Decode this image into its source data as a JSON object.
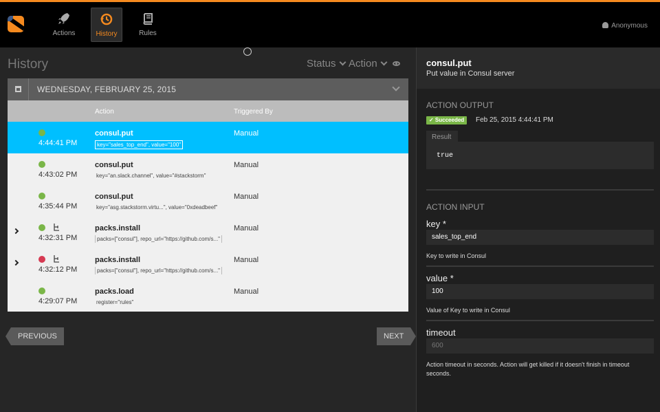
{
  "nav": {
    "items": [
      {
        "label": "Actions",
        "icon": "rocket-icon"
      },
      {
        "label": "History",
        "icon": "history-icon"
      },
      {
        "label": "Rules",
        "icon": "book-icon"
      }
    ],
    "user": "Anonymous"
  },
  "history": {
    "title": "History",
    "filters": {
      "status": "Status",
      "action": "Action"
    },
    "date": "WEDNESDAY, FEBRUARY 25, 2015",
    "columns": {
      "action": "Action",
      "triggered_by": "Triggered By"
    },
    "rows": [
      {
        "time": "4:44:41 PM",
        "action": "consul.put",
        "params": "key=\"sales_top_end\", value=\"100\"",
        "triggered_by": "Manual",
        "status": "succeeded",
        "status_color": "#7ab648",
        "expandable": false,
        "workflow": false
      },
      {
        "time": "4:43:02 PM",
        "action": "consul.put",
        "params": "key=\"an.slack.channel\", value=\"#stackstorm\"",
        "triggered_by": "Manual",
        "status": "succeeded",
        "status_color": "#7ab648",
        "expandable": false,
        "workflow": false
      },
      {
        "time": "4:35:44 PM",
        "action": "consul.put",
        "params": "key=\"asg.stackstorm.virtu...\", value=\"0xdeadbeef\"",
        "triggered_by": "Manual",
        "status": "succeeded",
        "status_color": "#7ab648",
        "expandable": false,
        "workflow": false
      },
      {
        "time": "4:32:31 PM",
        "action": "packs.install",
        "params": "packs=[\"consul\"], repo_url=\"https://github.com/s...\"",
        "triggered_by": "Manual",
        "status": "succeeded",
        "status_color": "#7ab648",
        "expandable": true,
        "workflow": true
      },
      {
        "time": "4:32:12 PM",
        "action": "packs.install",
        "params": "packs=[\"consul\"], repo_url=\"https://github.com/s...\"",
        "triggered_by": "Manual",
        "status": "failed",
        "status_color": "#d63a52",
        "expandable": true,
        "workflow": true
      },
      {
        "time": "4:29:07 PM",
        "action": "packs.load",
        "params": "register=\"rules\"",
        "triggered_by": "Manual",
        "status": "succeeded",
        "status_color": "#7ab648",
        "expandable": false,
        "workflow": false
      }
    ],
    "prev_label": "PREVIOUS",
    "next_label": "NEXT"
  },
  "details": {
    "title": "consul.put",
    "description": "Put value in Consul server",
    "output_heading": "ACTION OUTPUT",
    "status_badge": "✓ Succeeded",
    "timestamp": "Feb 25, 2015 4:44:41 PM",
    "result_tab": "Result",
    "result_value": "true",
    "input_heading": "ACTION INPUT",
    "fields": {
      "key": {
        "label": "key *",
        "value": "sales_top_end",
        "help": "Key to write in Consul"
      },
      "value": {
        "label": "value *",
        "value": "100",
        "help": "Value of Key to write in Consul"
      },
      "timeout": {
        "label": "timeout",
        "placeholder": "600",
        "help": "Action timeout in seconds. Action will get killed if it doesn't finish in timeout seconds."
      }
    }
  }
}
